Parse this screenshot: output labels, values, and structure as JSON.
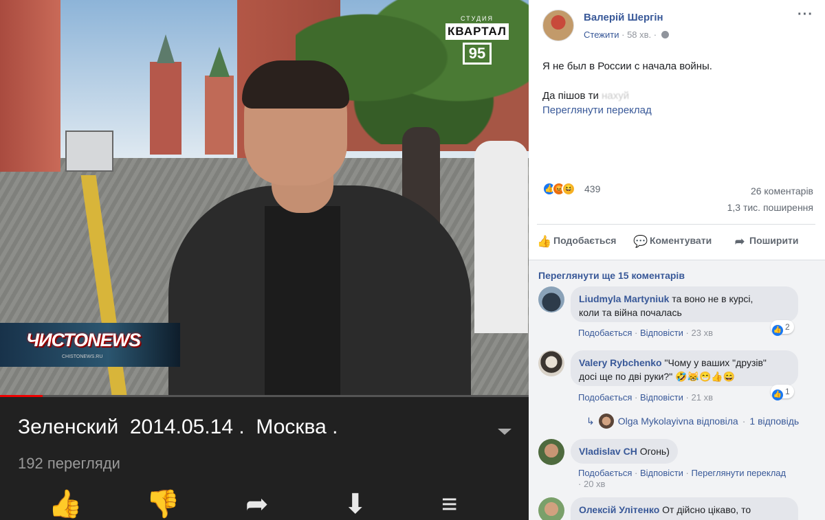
{
  "video": {
    "channel_logo": {
      "studio": "СТУДИЯ",
      "brand": "КВАРТАЛ",
      "number": "95"
    },
    "news_logo": "ЧИСТОNEWS",
    "news_logo_sub": "CHISTONEWS.RU",
    "title": "Зеленский  2014.05.14 .  Москва .",
    "views": "192 перегляди",
    "progress_percent": 8,
    "action_icons": [
      "like-icon",
      "dislike-icon",
      "share-icon",
      "download-icon",
      "add-to-playlist-icon"
    ],
    "colors": {
      "background": "#212121",
      "progress": "#e00000"
    }
  },
  "post": {
    "author": "Валерій Шергін",
    "follow": "Стежити",
    "time": "58 хв.",
    "text_line1": "Я не был в России с начала войны.",
    "text_line2_prefix": "Да пішов ти ",
    "text_line2_blurred": "нахуй",
    "translate": "Переглянути переклад",
    "reactions_count": "439",
    "comments_count": "26 коментарів",
    "shares_count": "1,3 тис. поширення",
    "actions": {
      "like": "Подобається",
      "comment": "Коментувати",
      "share": "Поширити"
    },
    "more_comments": "Переглянути ще 15 коментарів",
    "comment_actions": {
      "like": "Подобається",
      "reply": "Відповісти",
      "translate": "Переглянути переклад",
      "separator": "·"
    },
    "comments": [
      {
        "author": "Liudmyla Martyniuk",
        "text_line1": "та воно не в курсі,",
        "text_line2": "коли та війна почалась",
        "time": "23 хв",
        "likes": "2"
      },
      {
        "author": "Valery Rybchenko",
        "text_line1": "\"Чому у ваших \"друзів\"",
        "text_line2": "досі ще по дві руки?\" 🤣😹😁👍😄",
        "time": "21 хв",
        "likes": "1"
      },
      {
        "author": "Vladislav CH",
        "text": "Огонь)",
        "time": "20 хв"
      },
      {
        "author": "Олексій Улітенко",
        "text": "От дійсно цікаво, то"
      }
    ],
    "reply": {
      "author": "Olga Mykolayivna",
      "verb": "відповіла",
      "count": "1 відповідь"
    },
    "colors": {
      "link": "#385898",
      "bubble": "#e4e6eb",
      "like_blue": "#1877f2"
    }
  }
}
